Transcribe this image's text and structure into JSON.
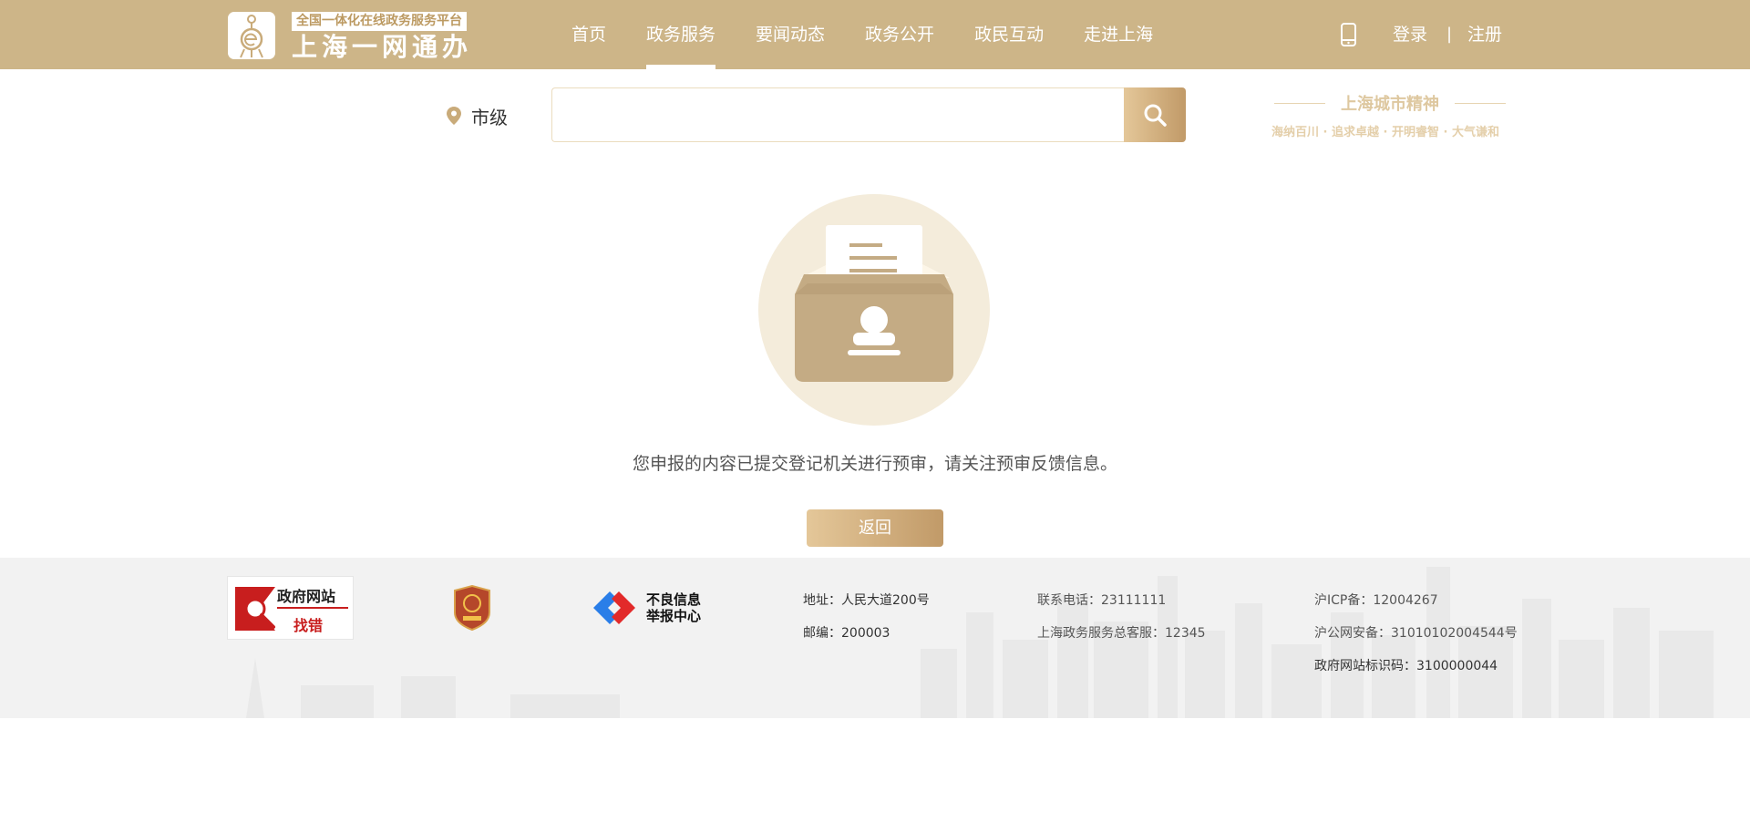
{
  "header": {
    "logo_tag": "全国一体化在线政务服务平台",
    "logo_name": "上海一网通办",
    "nav": [
      {
        "label": "首页"
      },
      {
        "label": "政务服务",
        "active": true
      },
      {
        "label": "要闻动态"
      },
      {
        "label": "政务公开"
      },
      {
        "label": "政民互动"
      },
      {
        "label": "走进上海"
      }
    ],
    "login": "登录",
    "separator": "|",
    "register": "注册"
  },
  "search": {
    "location": "市级",
    "placeholder": "",
    "value": ""
  },
  "spirit": {
    "title": "上海城市精神",
    "subtitle": "海纳百川 · 追求卓越 · 开明睿智 · 大气谦和"
  },
  "main": {
    "message": "您申报的内容已提交登记机关进行预审，请关注预审反馈信息。",
    "back_button": "返回"
  },
  "footer": {
    "logo1_line1": "政府网站",
    "logo1_line2": "找错",
    "logo3_line1": "不良信息",
    "logo3_line2": "举报中心",
    "address": "地址：人民大道200号",
    "postcode": "邮编：200003",
    "phone": "联系电话：23111111",
    "hotline": "上海政务服务总客服：12345",
    "icp": "沪ICP备：12004267",
    "police": "沪公网安备：31010102004544号",
    "site_id": "政府网站标识码：3100000044"
  },
  "colors": {
    "header_bg": "#cdb588",
    "accent_gold": "#c19a68",
    "footer_bg": "#f2f2f2"
  }
}
